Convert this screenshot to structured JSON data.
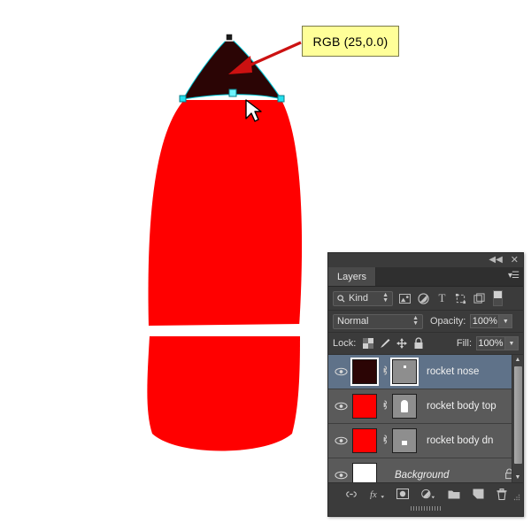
{
  "callout": {
    "text": "RGB (25,0.0)",
    "bg": "#ffff99",
    "arrow_color": "#cc1111"
  },
  "artwork": {
    "nose_color": "#2b0505",
    "body_color": "#ff0000",
    "background_color": "#ffffff",
    "path_color": "#00d8e8",
    "anchor_color": "#22e0ee"
  },
  "panel": {
    "topbar": {
      "collapse_icon": "◀◀",
      "close_icon": "✕"
    },
    "tab": {
      "label": "Layers",
      "menu_icon": "▾☰"
    },
    "filter": {
      "kind_label": "Kind",
      "search_icon": "search-icon",
      "spinner": "⬍",
      "icons": [
        "image-filter-icon",
        "adjustment-filter-icon",
        "type-filter-icon",
        "shape-filter-icon",
        "smartobject-filter-icon"
      ],
      "type_letter": "T",
      "toggle": "filter-toggle"
    },
    "blend": {
      "mode": "Normal",
      "opacity_label": "Opacity:",
      "opacity_value": "100%",
      "fill_label": "Fill:",
      "fill_value": "100%",
      "dropdown_icon": "▼"
    },
    "lock": {
      "label": "Lock:",
      "icons": [
        "transparency-lock-icon",
        "paint-lock-icon",
        "move-lock-icon",
        "all-lock-icon"
      ]
    },
    "layers": [
      {
        "name": "rocket nose",
        "thumb_color": "#2b0505",
        "selected": true,
        "has_mask": true,
        "mask_shape": "dot",
        "visible": true,
        "locked": false,
        "italic": false
      },
      {
        "name": "rocket body top",
        "thumb_color": "#ff0000",
        "selected": false,
        "has_mask": true,
        "mask_shape": "dome",
        "visible": true,
        "locked": false,
        "italic": false
      },
      {
        "name": "rocket body dn",
        "thumb_color": "#ff0000",
        "selected": false,
        "has_mask": true,
        "mask_shape": "square",
        "visible": true,
        "locked": false,
        "italic": false
      },
      {
        "name": "Background",
        "thumb_color": "#ffffff",
        "selected": false,
        "has_mask": false,
        "mask_shape": "",
        "visible": true,
        "locked": true,
        "italic": true
      }
    ],
    "bottom_icons": [
      "link-layers-icon",
      "layer-fx-icon",
      "layer-mask-icon",
      "adjustment-layer-icon",
      "new-group-icon",
      "new-layer-icon",
      "delete-layer-icon"
    ],
    "eye_icon": "visibility-eye-icon",
    "link_icon": "link-icon",
    "lock_badge_icon": "lock-icon"
  }
}
